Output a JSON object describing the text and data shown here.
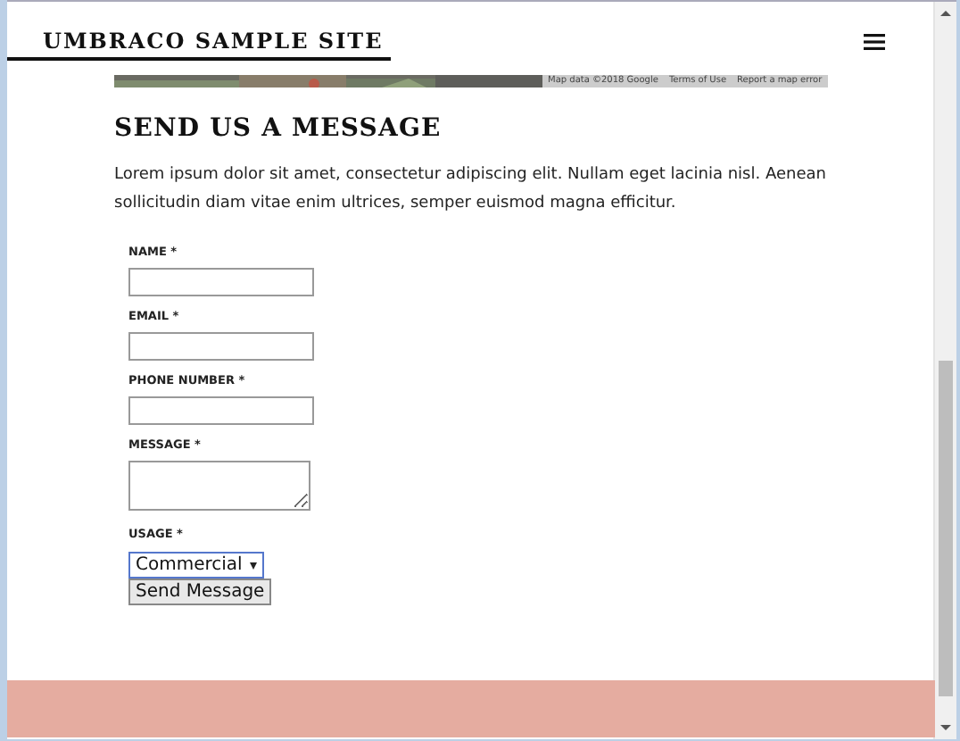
{
  "header": {
    "site_title": "UMBRACO SAMPLE SITE"
  },
  "map": {
    "kind": "picture",
    "attribution": [
      "Map data ©2018 Google",
      "Terms of Use",
      "Report a map error"
    ]
  },
  "heading": "SEND US A MESSAGE",
  "intro": "Lorem ipsum dolor sit amet, consectetur adipiscing elit. Nullam eget lacinia nisl. Aenean sollicitudin diam vitae enim ultrices, semper euismod magna efficitur.",
  "form": {
    "fields": [
      {
        "label": "NAME *",
        "kind": "text"
      },
      {
        "label": "EMAIL *",
        "kind": "text"
      },
      {
        "label": "PHONE NUMBER *",
        "kind": "text"
      },
      {
        "label": "MESSAGE *",
        "kind": "textarea"
      },
      {
        "label": "USAGE *",
        "kind": "select",
        "value": "Commercial"
      }
    ],
    "submit": "Send Message"
  }
}
